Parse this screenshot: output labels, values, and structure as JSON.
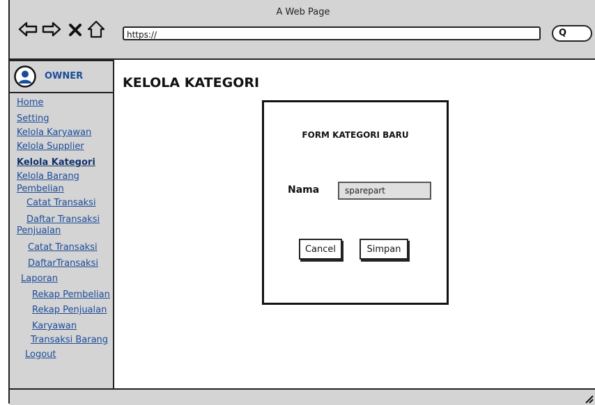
{
  "window": {
    "title": "A Web Page"
  },
  "browser": {
    "url": "https://",
    "search_glyph": "Q",
    "icons": [
      "back-arrow-icon",
      "forward-arrow-icon",
      "close-x-icon",
      "home-icon"
    ]
  },
  "sidebar": {
    "owner_label": "OWNER",
    "items": [
      {
        "label": "Home"
      },
      {
        "label": "Setting"
      },
      {
        "label": "Kelola Karyawan"
      },
      {
        "label": "Kelola Supplier"
      },
      {
        "label": "Kelola Kategori"
      },
      {
        "label": "Kelola Barang"
      },
      {
        "label": "Pembelian"
      },
      {
        "label": "Catat Transaksi"
      },
      {
        "label": "Daftar Transaksi"
      },
      {
        "label": "Penjualan"
      },
      {
        "label": "Catat Transaksi"
      },
      {
        "label": "DaftarTransaksi"
      },
      {
        "label": "Laporan"
      },
      {
        "label": "Rekap Pembelian"
      },
      {
        "label": "Rekap Penjualan"
      },
      {
        "label": "Karyawan"
      },
      {
        "label": "Transaksi Barang"
      },
      {
        "label": "Logout"
      }
    ]
  },
  "main": {
    "page_title": "KELOLA KATEGORI",
    "form": {
      "heading": "FORM KATEGORI BARU",
      "field_label": "Nama",
      "field_value": "sparepart",
      "cancel_label": "Cancel",
      "save_label": "Simpan"
    }
  },
  "colors": {
    "chrome": "#d4d4d4",
    "link": "#1b4c9a",
    "border": "#222222"
  }
}
